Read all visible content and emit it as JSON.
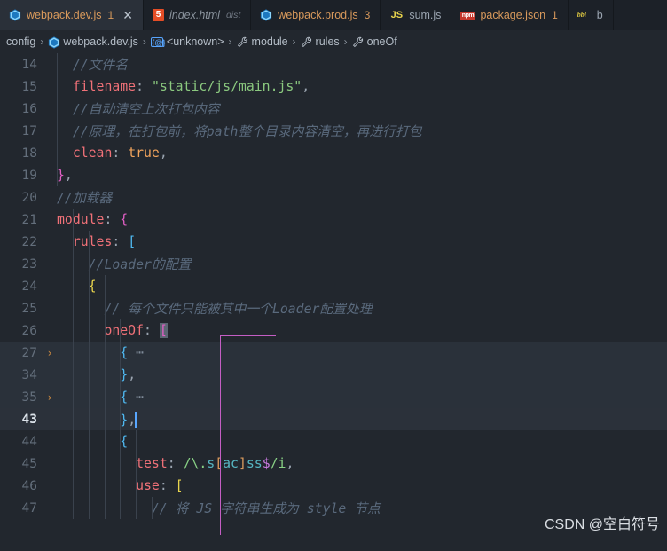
{
  "tabs": [
    {
      "label": "webpack.dev.js",
      "badge": "1",
      "icon": "webpack-icon",
      "active": true,
      "closable": true,
      "style": "normal",
      "suffix": ""
    },
    {
      "label": "index.html",
      "badge": "",
      "icon": "html5-icon",
      "active": false,
      "closable": false,
      "style": "italic",
      "suffix": "dist"
    },
    {
      "label": "webpack.prod.js",
      "badge": "3",
      "icon": "webpack-icon",
      "active": false,
      "closable": false,
      "style": "normal",
      "suffix": ""
    },
    {
      "label": "sum.js",
      "badge": "",
      "icon": "js-icon",
      "active": false,
      "closable": false,
      "style": "normal",
      "suffix": ""
    },
    {
      "label": "package.json",
      "badge": "1",
      "icon": "npm-icon",
      "active": false,
      "closable": false,
      "style": "normal",
      "suffix": ""
    },
    {
      "label": "b",
      "badge": "",
      "icon": "babel-icon",
      "active": false,
      "closable": false,
      "style": "normal",
      "suffix": ""
    }
  ],
  "tab_close_glyph": "✕",
  "breadcrumb": {
    "separator": "›",
    "items": [
      {
        "label": "config",
        "icon": ""
      },
      {
        "label": "webpack.dev.js",
        "icon": "webpack-icon"
      },
      {
        "label": "<unknown>",
        "icon": "symbol-object-icon"
      },
      {
        "label": "module",
        "icon": "wrench-icon"
      },
      {
        "label": "rules",
        "icon": "wrench-icon"
      },
      {
        "label": "oneOf",
        "icon": "wrench-icon"
      }
    ]
  },
  "editor": {
    "fold_glyph": "›",
    "lines": [
      {
        "num": "14",
        "fold": false,
        "active": false,
        "tokens": [
          {
            "t": "  //文件名",
            "c": "c-com"
          }
        ]
      },
      {
        "num": "15",
        "fold": false,
        "active": false,
        "tokens": [
          {
            "t": "  ",
            "c": "c-plain"
          },
          {
            "t": "filename",
            "c": "c-prop"
          },
          {
            "t": ": ",
            "c": "c-punc"
          },
          {
            "t": "\"static/js/main.js\"",
            "c": "c-str"
          },
          {
            "t": ",",
            "c": "c-punc"
          }
        ]
      },
      {
        "num": "16",
        "fold": false,
        "active": false,
        "tokens": [
          {
            "t": "  //自动清空上次打包内容",
            "c": "c-com"
          }
        ]
      },
      {
        "num": "17",
        "fold": false,
        "active": false,
        "tokens": [
          {
            "t": "  //原理，在打包前，将path整个目录内容清空，再进行打包",
            "c": "c-com"
          }
        ]
      },
      {
        "num": "18",
        "fold": false,
        "active": false,
        "tokens": [
          {
            "t": "  ",
            "c": "c-plain"
          },
          {
            "t": "clean",
            "c": "c-prop"
          },
          {
            "t": ": ",
            "c": "c-punc"
          },
          {
            "t": "true",
            "c": "c-bool"
          },
          {
            "t": ",",
            "c": "c-punc"
          }
        ]
      },
      {
        "num": "19",
        "fold": false,
        "active": false,
        "tokens": [
          {
            "t": "}",
            "c": "c-br-pink"
          },
          {
            "t": ",",
            "c": "c-punc"
          }
        ]
      },
      {
        "num": "20",
        "fold": false,
        "active": false,
        "tokens": [
          {
            "t": "//加载器",
            "c": "c-com"
          }
        ]
      },
      {
        "num": "21",
        "fold": false,
        "active": false,
        "tokens": [
          {
            "t": "module",
            "c": "c-prop"
          },
          {
            "t": ": ",
            "c": "c-punc"
          },
          {
            "t": "{",
            "c": "c-br-pink"
          }
        ]
      },
      {
        "num": "22",
        "fold": false,
        "active": false,
        "tokens": [
          {
            "t": "  ",
            "c": "c-plain"
          },
          {
            "t": "rules",
            "c": "c-prop"
          },
          {
            "t": ": ",
            "c": "c-punc"
          },
          {
            "t": "[",
            "c": "c-br-blue"
          }
        ]
      },
      {
        "num": "23",
        "fold": false,
        "active": false,
        "tokens": [
          {
            "t": "    //Loader的配置",
            "c": "c-com"
          }
        ]
      },
      {
        "num": "24",
        "fold": false,
        "active": false,
        "tokens": [
          {
            "t": "    ",
            "c": "c-plain"
          },
          {
            "t": "{",
            "c": "c-br-yel"
          }
        ]
      },
      {
        "num": "25",
        "fold": false,
        "active": false,
        "tokens": [
          {
            "t": "      // 每个文件只能被其中一个Loader配置处理",
            "c": "c-com"
          }
        ]
      },
      {
        "num": "26",
        "fold": false,
        "active": false,
        "tokens": [
          {
            "t": "      ",
            "c": "c-plain"
          },
          {
            "t": "oneOf",
            "c": "c-prop"
          },
          {
            "t": ": ",
            "c": "c-punc"
          },
          {
            "t": "[",
            "c": "sel-bracket"
          }
        ]
      },
      {
        "num": "27",
        "fold": true,
        "active": false,
        "hl": true,
        "tokens": [
          {
            "t": "        ",
            "c": "c-plain"
          },
          {
            "t": "{",
            "c": "c-br-blue"
          },
          {
            "t": " ⋯",
            "c": "c-dots"
          }
        ]
      },
      {
        "num": "34",
        "fold": false,
        "active": false,
        "hl": true,
        "tokens": [
          {
            "t": "        ",
            "c": "c-plain"
          },
          {
            "t": "}",
            "c": "c-br-blue"
          },
          {
            "t": ",",
            "c": "c-punc"
          }
        ]
      },
      {
        "num": "35",
        "fold": true,
        "active": false,
        "hl": true,
        "tokens": [
          {
            "t": "        ",
            "c": "c-plain"
          },
          {
            "t": "{",
            "c": "c-br-blue"
          },
          {
            "t": " ⋯",
            "c": "c-dots"
          }
        ]
      },
      {
        "num": "43",
        "fold": false,
        "active": true,
        "tokens": [
          {
            "t": "        ",
            "c": "c-plain"
          },
          {
            "t": "}",
            "c": "c-br-blue"
          },
          {
            "t": ",",
            "c": "c-punc"
          },
          {
            "t": "|cursor|",
            "c": "cursor"
          }
        ]
      },
      {
        "num": "44",
        "fold": false,
        "active": false,
        "tokens": [
          {
            "t": "        ",
            "c": "c-plain"
          },
          {
            "t": "{",
            "c": "c-br-blue"
          }
        ]
      },
      {
        "num": "45",
        "fold": false,
        "active": false,
        "tokens": [
          {
            "t": "          ",
            "c": "c-plain"
          },
          {
            "t": "test",
            "c": "c-prop"
          },
          {
            "t": ": ",
            "c": "c-punc"
          },
          {
            "t": "/\\.",
            "c": "c-regex"
          },
          {
            "t": "s",
            "c": "c-regex-cls"
          },
          {
            "t": "[",
            "c": "c-regex-br"
          },
          {
            "t": "ac",
            "c": "c-regex-cls"
          },
          {
            "t": "]",
            "c": "c-regex-br"
          },
          {
            "t": "ss",
            "c": "c-regex-cls"
          },
          {
            "t": "$",
            "c": "c-regex-anchor"
          },
          {
            "t": "/i",
            "c": "c-regex"
          },
          {
            "t": ",",
            "c": "c-punc"
          }
        ]
      },
      {
        "num": "46",
        "fold": false,
        "active": false,
        "tokens": [
          {
            "t": "          ",
            "c": "c-plain"
          },
          {
            "t": "use",
            "c": "c-prop"
          },
          {
            "t": ": ",
            "c": "c-punc"
          },
          {
            "t": "[",
            "c": "c-br-yel"
          }
        ]
      },
      {
        "num": "47",
        "fold": false,
        "active": false,
        "tokens": [
          {
            "t": "            // 将 JS 字符串生成为 style 节点",
            "c": "c-com"
          }
        ]
      }
    ]
  },
  "watermark": "CSDN @空白符号",
  "colors": {
    "background": "#22272e",
    "tabbar_background": "#1c2128",
    "active_tab_background": "#2a3039",
    "accent_orange": "#d99a5c",
    "cursor_blue": "#58a6ff",
    "bracket_guide_magenta": "#c45ec4",
    "comment_gray": "#5a6a7d",
    "string_green": "#8bc97f",
    "property_red": "#f07178"
  }
}
